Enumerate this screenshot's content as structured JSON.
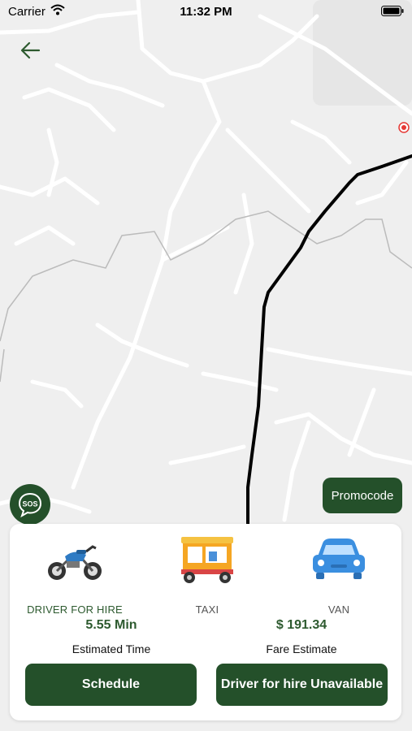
{
  "status_bar": {
    "carrier": "Carrier",
    "time": "11:32 PM"
  },
  "map": {
    "route_color": "#000000",
    "road_color": "#ffffff",
    "background_color": "#efefef"
  },
  "sos": {
    "label": "SOS"
  },
  "promo": {
    "label": "Promocode"
  },
  "vehicles": [
    {
      "label": "DRIVER FOR HIRE",
      "icon": "motorcycle-icon",
      "selected": true
    },
    {
      "label": "TAXI",
      "icon": "auto-rickshaw-icon",
      "selected": false
    },
    {
      "label": "VAN",
      "icon": "car-icon",
      "selected": false
    }
  ],
  "estimates": {
    "time_value": "5.55 Min",
    "time_caption": "Estimated Time",
    "fare_value": "$ 191.34",
    "fare_caption": "Fare Estimate"
  },
  "actions": {
    "schedule_label": "Schedule",
    "unavailable_label": "Driver for hire Unavailable"
  },
  "colors": {
    "primary": "#24502a",
    "accent_text": "#2d5a2f",
    "location_marker": "#e53935"
  }
}
